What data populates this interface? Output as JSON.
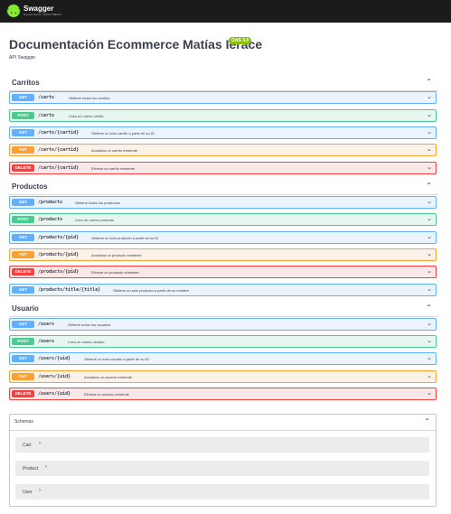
{
  "header": {
    "logo_glyph": "{..}",
    "logo_name": "Swagger",
    "logo_sub": "Supported by SMARTBEAR"
  },
  "info": {
    "title": "Documentación Ecommerce Matías Ierace",
    "version_badge": "OAS 3.0",
    "description": "API Swagger"
  },
  "colors": {
    "get": "#61affe",
    "post": "#49cc90",
    "put": "#fca130",
    "delete": "#f93e3e",
    "version_badge": "#89bf04",
    "topbar": "#1b1b1b"
  },
  "icons": {
    "tag_toggle": "chevron-up-icon",
    "operation_toggle": "chevron-down-icon",
    "model_expand": "chevron-right-icon"
  },
  "glyphs": {
    "chevron_up": "⌃",
    "chevron_down": "⌄",
    "chevron_right": "›"
  },
  "tags": [
    {
      "name": "Carritos",
      "operations": [
        {
          "method": "GET",
          "path": "/carts",
          "summary": "Obtiene todos los carritos"
        },
        {
          "method": "POST",
          "path": "/carts",
          "summary": "Crea un nuevo carrito"
        },
        {
          "method": "GET",
          "path": "/carts/{cartid}",
          "summary": "Obtiene un solo carrito a partir de su ID"
        },
        {
          "method": "PUT",
          "path": "/carts/{cartid}",
          "summary": "Actualiza un carrito existente"
        },
        {
          "method": "DELETE",
          "path": "/carts/{cartid}",
          "summary": "Elimina un carrito existente"
        }
      ]
    },
    {
      "name": "Productos",
      "operations": [
        {
          "method": "GET",
          "path": "/products",
          "summary": "Obtiene todos los productos"
        },
        {
          "method": "POST",
          "path": "/products",
          "summary": "Crea un nuevo producto"
        },
        {
          "method": "GET",
          "path": "/products/{pid}",
          "summary": "Obtiene un solo producto a partir de su ID"
        },
        {
          "method": "PUT",
          "path": "/products/{pid}",
          "summary": "Actualiza un producto existente"
        },
        {
          "method": "DELETE",
          "path": "/products/{pid}",
          "summary": "Elimina un producto existente"
        },
        {
          "method": "GET",
          "path": "/products/title/{title}",
          "summary": "Obtiene un solo producto a partir de su nombre"
        }
      ]
    },
    {
      "name": "Usuario",
      "operations": [
        {
          "method": "GET",
          "path": "/users",
          "summary": "Obtiene todos los usuarios"
        },
        {
          "method": "POST",
          "path": "/users",
          "summary": "Crea un nuevo usuario"
        },
        {
          "method": "GET",
          "path": "/users/{uid}",
          "summary": "Obtiene un solo usuario a partir de su ID"
        },
        {
          "method": "PUT",
          "path": "/users/{uid}",
          "summary": "Actualiza un usuario existente"
        },
        {
          "method": "DELETE",
          "path": "/users/{uid}",
          "summary": "Elimina un usuario existente"
        }
      ]
    }
  ],
  "schemas": {
    "title": "Schemas",
    "models": [
      "Cart",
      "Product",
      "User"
    ]
  }
}
